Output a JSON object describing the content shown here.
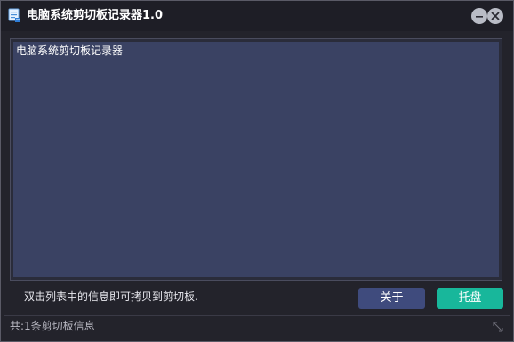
{
  "window": {
    "title": "电脑系统剪切板记录器1.0",
    "app_icon": "clipboard-icon",
    "controls": {
      "minimize_icon": "minimize-icon",
      "close_icon": "close-icon"
    }
  },
  "clipboard_list": {
    "items": [
      "电脑系统剪切板记录器"
    ]
  },
  "footer": {
    "hint": "双击列表中的信息即可拷贝到剪切板.",
    "about_label": "关于",
    "tray_label": "托盘"
  },
  "statusbar": {
    "text": "共:1条剪切板信息",
    "grip_icon": "resize-grip-icon"
  },
  "colors": {
    "window_bg": "#23232b",
    "list_bg": "#3a4263",
    "about_button": "#3f4b7d",
    "tray_button": "#18b79b"
  }
}
